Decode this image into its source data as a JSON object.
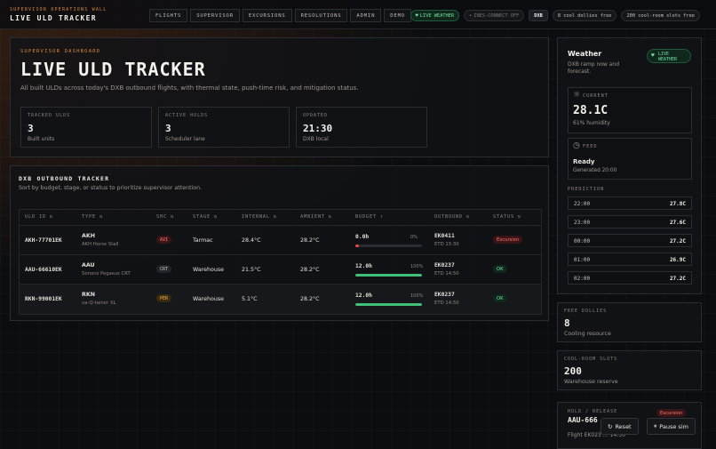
{
  "header": {
    "eyebrow": "SUPERVISOR OPERATIONS WALL",
    "title": "LIVE ULD TRACKER",
    "nav": [
      "FLIGHTS",
      "SUPERVISOR",
      "EXCURSIONS",
      "RESOLUTIONS",
      "ADMIN",
      "DEMO"
    ],
    "pills": {
      "live_weather": "LIVE WEATHER",
      "iness": "INES-CONNECT OFF",
      "airport": "DXB",
      "dollies": "8 cool dollies free",
      "slots": "200 cool-room slots free"
    }
  },
  "hero": {
    "eyebrow": "SUPERVISOR DASHBOARD",
    "title": "LIVE ULD TRACKER",
    "description": "All built ULDs across today's DXB outbound flights, with thermal state, push-time risk, and mitigation status.",
    "stats": [
      {
        "label": "TRACKED ULDS",
        "value": "3",
        "sub": "Built units"
      },
      {
        "label": "ACTIVE HOLDS",
        "value": "3",
        "sub": "Scheduler lane"
      },
      {
        "label": "UPDATED",
        "value": "21:30",
        "sub": "DXB local"
      }
    ]
  },
  "tracker": {
    "title": "DXB OUTBOUND TRACKER",
    "description": "Sort by budget, stage, or status to prioritize supervisor attention.",
    "columns": {
      "uld": "ULD ID ⇅",
      "type": "TYPE ⇅",
      "shc": "SHC ⇅",
      "stage": "STAGE ⇅",
      "internal": "INTERNAL ⇅",
      "ambient": "AMBIENT ⇅",
      "budget": "BUDGET ↑",
      "outbound": "OUTBOUND ⇅",
      "status": "STATUS ⇅"
    },
    "rows": [
      {
        "id": "AKH-77701EK",
        "type": "AKH",
        "type_sub": "AKH Horse Stall",
        "shc": "AVI",
        "stage": "Tarmac",
        "internal": "28.4°C",
        "ambient": "28.2°C",
        "budget": "0.0h",
        "pct": "0%",
        "fill": 0.05,
        "flight": "EK0411",
        "etd": "ETD 15:30",
        "status": "Excursion",
        "status_color": "#ff7a6e",
        "bar_color": "#ef4a3c"
      },
      {
        "id": "AAU-66610EK",
        "type": "AAU",
        "type_sub": "Sonoco Pegasus CRT",
        "shc": "CRT",
        "stage": "Warehouse",
        "internal": "21.5°C",
        "ambient": "28.2°C",
        "budget": "12.0h",
        "pct": "100%",
        "fill": 1,
        "flight": "EK0237",
        "etd": "ETD 14:50",
        "status": "OK",
        "status_color": "#6fe0a3",
        "bar_color": "#3fbf78"
      },
      {
        "id": "RKN-99001EK",
        "type": "RKN",
        "type_sub": "va-Q-tainer XL",
        "shc": "PER",
        "stage": "Warehouse",
        "internal": "5.1°C",
        "ambient": "28.2°C",
        "budget": "12.0h",
        "pct": "100%",
        "fill": 1,
        "flight": "EK0237",
        "etd": "ETD 14:50",
        "status": "OK",
        "status_color": "#6fe0a3",
        "bar_color": "#3fbf78"
      }
    ]
  },
  "weather": {
    "title": "Weather",
    "description": "DXB ramp now and forecast.",
    "pill": "LIVE WEATHER",
    "current_label": "CURRENT",
    "current_value": "28.1C",
    "current_sub": "61% humidity",
    "feed_label": "FEED",
    "feed_value": "Ready",
    "feed_sub": "Generated 20:00",
    "prediction_label": "PREDICTION",
    "predictions": [
      {
        "time": "22:00",
        "temp": "27.8C"
      },
      {
        "time": "23:00",
        "temp": "27.6C"
      },
      {
        "time": "00:00",
        "temp": "27.2C"
      },
      {
        "time": "01:00",
        "temp": "26.9C"
      },
      {
        "time": "02:00",
        "temp": "27.2C"
      }
    ]
  },
  "dollies": {
    "label": "FREE DOLLIES",
    "value": "8",
    "sub": "Cooling resource"
  },
  "slots": {
    "label": "COOL-ROOM SLOTS",
    "value": "200",
    "sub": "Warehouse reserve"
  },
  "hold": {
    "label": "HOLD / RELEASE",
    "id": "AAU-666",
    "sub": "Flight EK023  … 14:50",
    "badge": "Excursion"
  },
  "buttons": {
    "reset": "Reset",
    "pause": "Pause sim"
  }
}
